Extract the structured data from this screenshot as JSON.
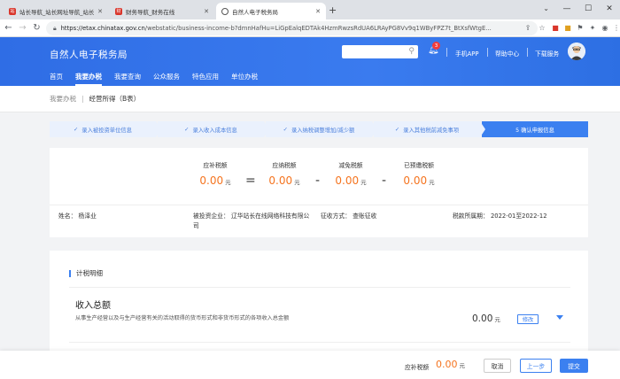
{
  "browser": {
    "tabs": [
      {
        "title": "站长导航_站长网址导航_站长网址大全",
        "favicon_color": "#d9362b",
        "favicon_text": "站"
      },
      {
        "title": "财务导航_财务在线",
        "favicon_color": "#d9362b",
        "favicon_text": "财"
      },
      {
        "title": "自然人电子税务局",
        "favicon_color": "#555555",
        "favicon_text": ""
      }
    ],
    "url_host": "https://etax.chinatax.gov.cn",
    "url_path": "/webstatic/business-income-b?dmnHafHu=LiGpEalqEDTAk4HzmRwzsRdUA6LRAyPG8Vv9q1WByFPZ7t_BtXsfWtgE..."
  },
  "header": {
    "brand": "自然人电子税务局",
    "notification_count": "3",
    "links": [
      "手机APP",
      "帮助中心",
      "下载服务"
    ],
    "menu": [
      {
        "label": "首页",
        "active": false
      },
      {
        "label": "我要办税",
        "active": true
      },
      {
        "label": "我要查询",
        "active": false
      },
      {
        "label": "公众服务",
        "active": false
      },
      {
        "label": "特色应用",
        "active": false
      },
      {
        "label": "单位办税",
        "active": false
      }
    ]
  },
  "breadcrumb": {
    "parent": "我要办税",
    "current": "经营所得（B表）"
  },
  "steps": [
    {
      "label": "录入被投资单位信息",
      "done": true
    },
    {
      "label": "录入收入成本信息",
      "done": true
    },
    {
      "label": "录入纳税调整增加/减少额",
      "done": true
    },
    {
      "label": "录入其他税前减免事项",
      "done": true
    },
    {
      "label": "5  确认申报信息",
      "done": false
    }
  ],
  "summary": {
    "payable_label": "应补税额",
    "payable": "0.00",
    "tax_label": "应纳税额",
    "tax": "0.00",
    "relief_label": "减免税额",
    "relief": "0.00",
    "prepaid_label": "已预缴税额",
    "prepaid": "0.00",
    "unit": "元",
    "eq": "=",
    "minus": "-"
  },
  "info": {
    "name": "姓名：  杨泽业",
    "company": "被投资企业：  辽华站长在线网络科技有限公司",
    "method": "征收方式：  查账征收",
    "period": "税款所属期：  2022-01至2022-12"
  },
  "detail": {
    "section_title": "计税明细",
    "income_title": "收入总额",
    "income_desc": "从事生产经营以及与生产经营有关的活动取得的货币形式和非货币形式的各项收入总金额",
    "income_amount": "0.00",
    "unit": "元",
    "edit_label": "修改"
  },
  "bottom": {
    "label": "应补税额",
    "value": "0.00",
    "unit": "元",
    "cancel": "取消",
    "prev": "上一步",
    "submit": "提交"
  },
  "colors": {
    "primary": "#3b80f0",
    "amount": "#f5741f"
  }
}
